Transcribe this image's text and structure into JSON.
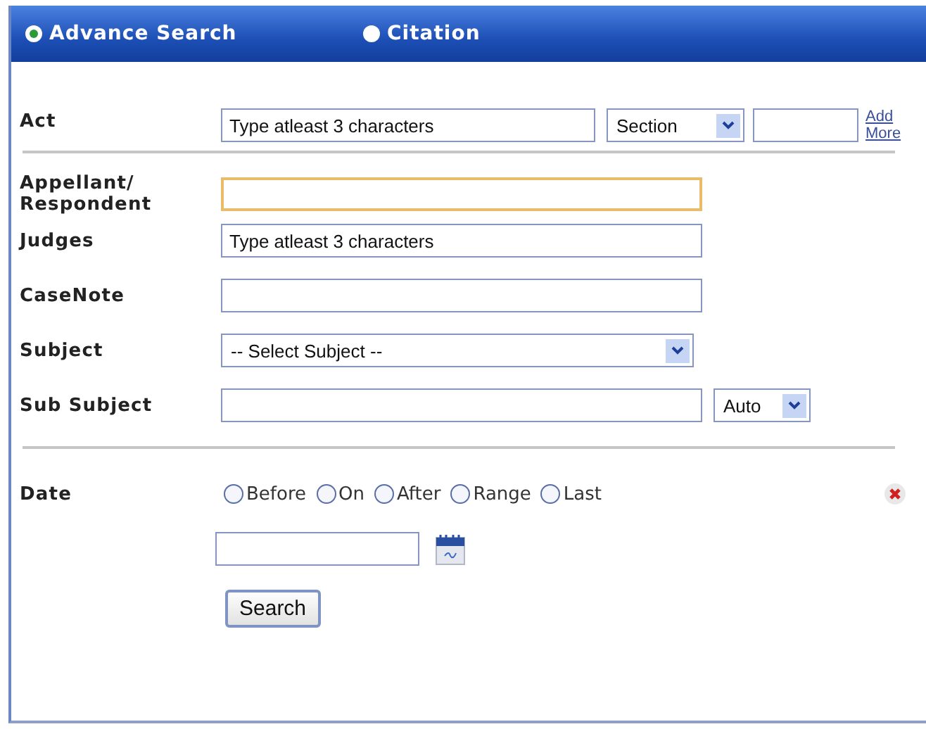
{
  "tabs": [
    {
      "label": "Advance Search",
      "selected": true
    },
    {
      "label": "Citation",
      "selected": false
    }
  ],
  "act": {
    "label": "Act",
    "value": "Type atleast 3 characters",
    "section": "Section",
    "link": [
      "Add",
      "More"
    ]
  },
  "fields": [
    {
      "kind": "text",
      "label": [
        "Appellant/",
        "Respondent"
      ],
      "focused": true
    },
    {
      "kind": "text",
      "label": [
        "Judges"
      ],
      "value": "Type atleast 3 characters",
      "focused": false
    },
    {
      "kind": "text",
      "label": [
        "CaseNote"
      ],
      "focused": false
    },
    {
      "kind": "select",
      "label": [
        "Subject"
      ],
      "value": "-- Select Subject --"
    },
    {
      "kind": "text-select",
      "label": [
        "Sub Subject"
      ],
      "option": "Auto",
      "focused": false
    }
  ],
  "date": {
    "label": "Date",
    "options": [
      {
        "label": "Before",
        "selected": false
      },
      {
        "label": "On",
        "selected": false
      },
      {
        "label": "After",
        "selected": false
      },
      {
        "label": "Range",
        "selected": false
      },
      {
        "label": "Last",
        "selected": false
      }
    ]
  },
  "search_button": "Search"
}
